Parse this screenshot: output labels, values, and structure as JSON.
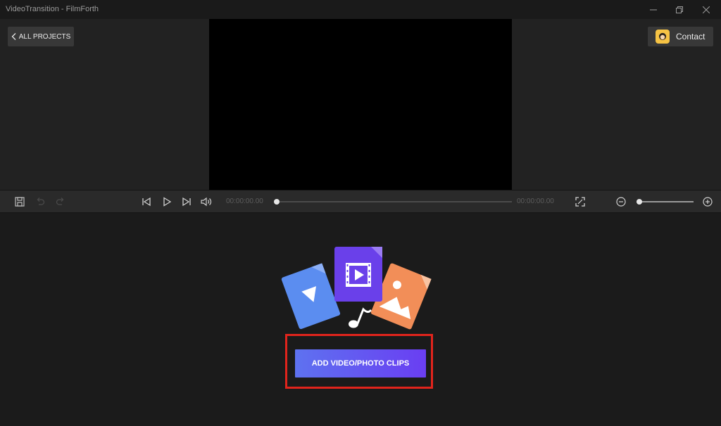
{
  "window": {
    "title": "VideoTransition - FilmForth"
  },
  "header": {
    "all_projects_label": "ALL PROJECTS",
    "contact_label": "Contact"
  },
  "player": {
    "current_time": "00:00:00.00",
    "total_time": "00:00:00.00",
    "progress": 0,
    "zoom_level": 0.05
  },
  "workspace": {
    "add_clips_label": "ADD VIDEO/PHOTO CLIPS"
  },
  "colors": {
    "accent_start": "#5e72f0",
    "accent_end": "#6a3ef2",
    "highlight": "#e1241c",
    "background": "#1b1b1b"
  }
}
